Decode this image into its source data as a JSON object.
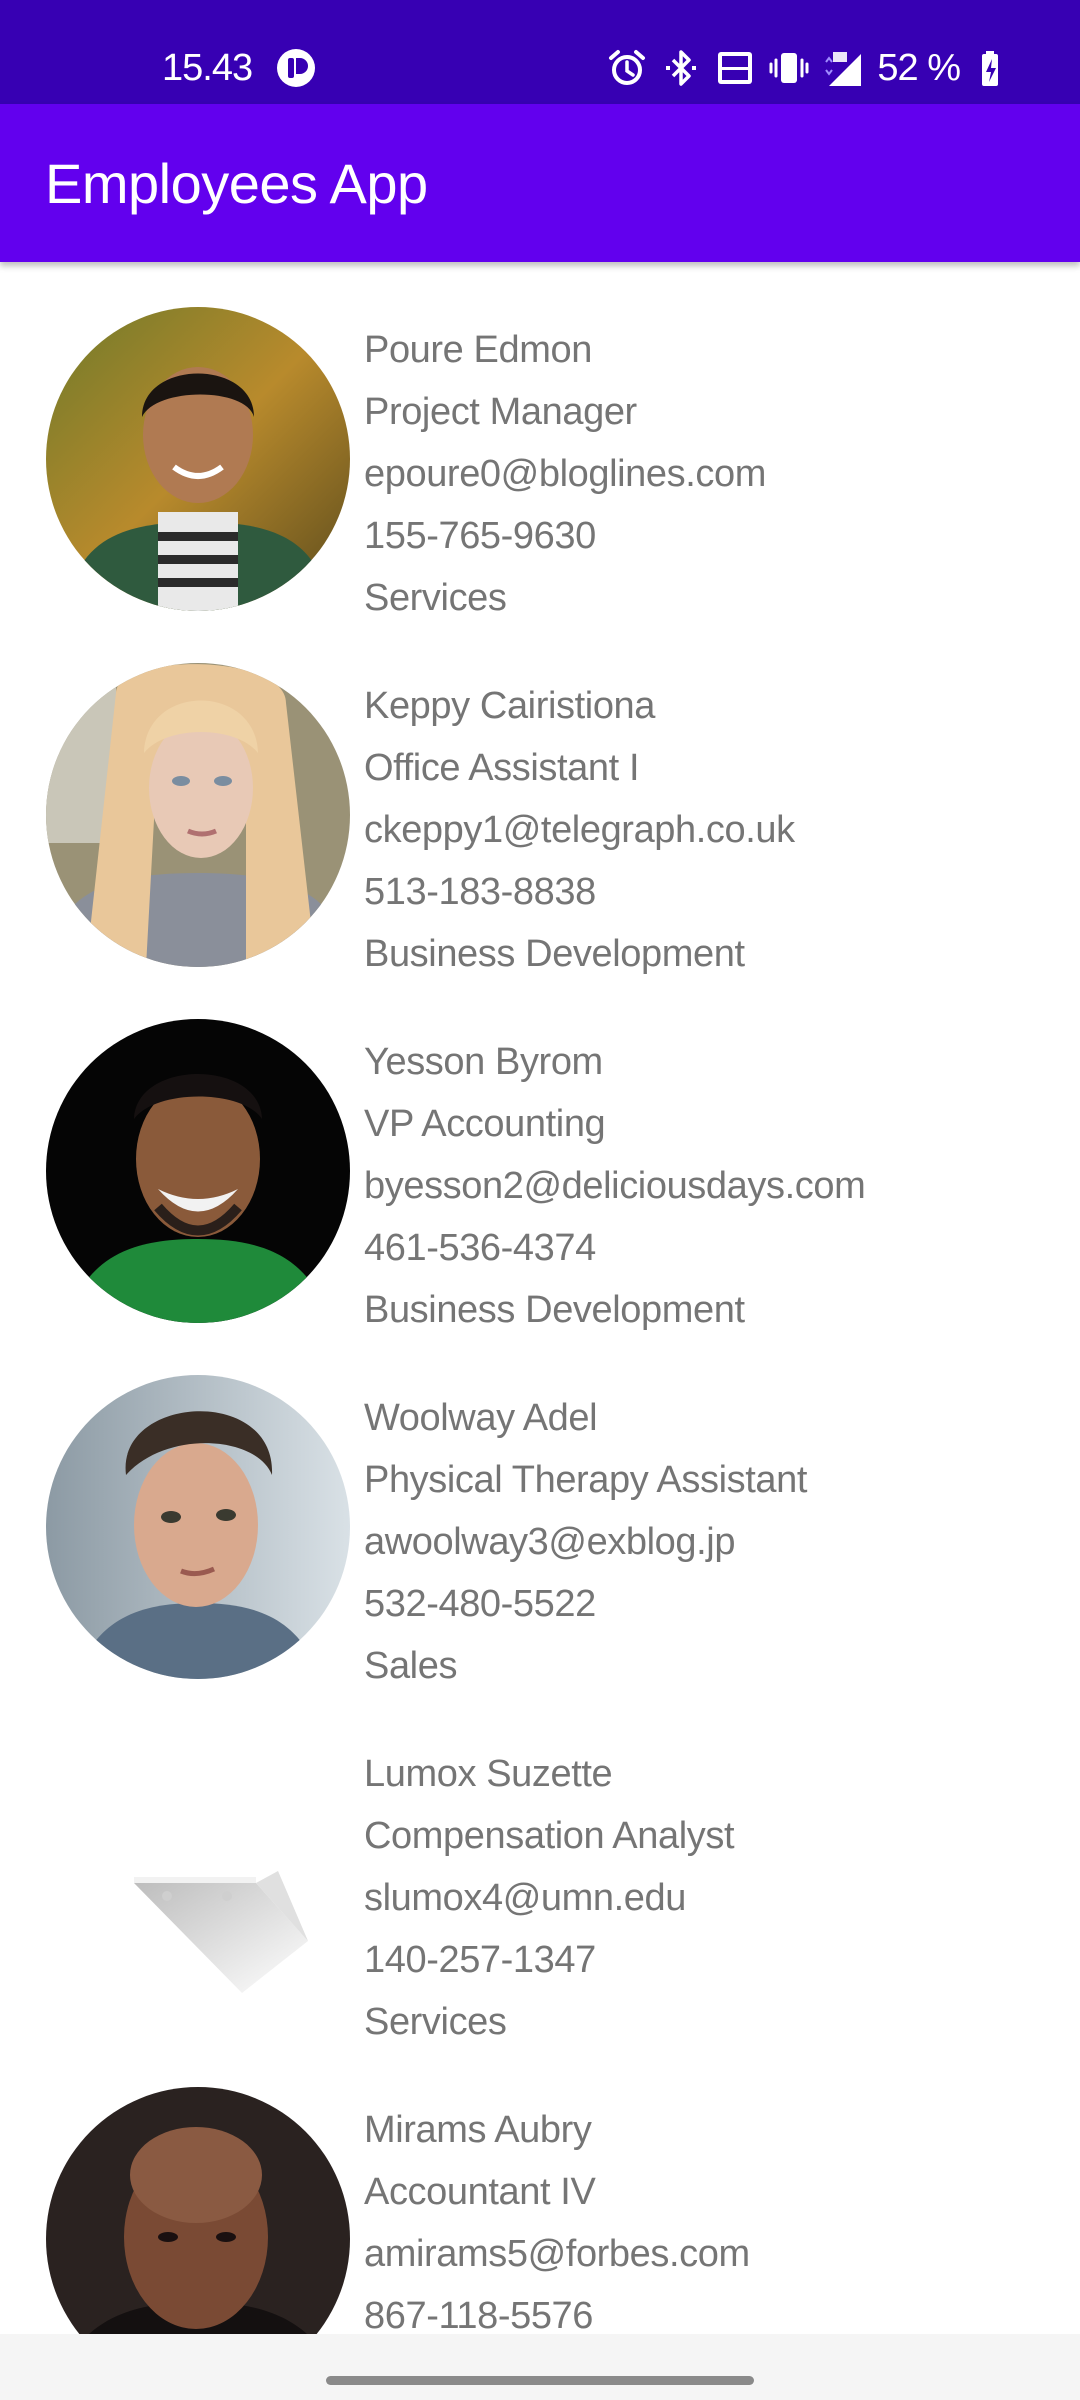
{
  "status_bar": {
    "time": "15.43",
    "battery": "52 %",
    "icons": [
      "notification-icon",
      "alarm-icon",
      "bluetooth-icon",
      "volte-icon",
      "vibrate-icon",
      "signal-4g-icon",
      "battery-charging-icon"
    ]
  },
  "app_bar": {
    "title": "Employees App"
  },
  "colors": {
    "status_bar": "#3700b3",
    "app_bar": "#6200ee",
    "text": "#757575"
  },
  "employees": [
    {
      "name": "Poure Edmon",
      "title": "Project Manager",
      "email": "epoure0@bloglines.com",
      "phone": "155-765-9630",
      "department": "Services"
    },
    {
      "name": "Keppy Cairistiona",
      "title": "Office Assistant I",
      "email": "ckeppy1@telegraph.co.uk",
      "phone": "513-183-8838",
      "department": "Business Development"
    },
    {
      "name": "Yesson Byrom",
      "title": "VP Accounting",
      "email": "byesson2@deliciousdays.com",
      "phone": "461-536-4374",
      "department": "Business Development"
    },
    {
      "name": "Woolway Adel",
      "title": "Physical Therapy Assistant",
      "email": "awoolway3@exblog.jp",
      "phone": "532-480-5522",
      "department": "Sales"
    },
    {
      "name": "Lumox Suzette",
      "title": "Compensation Analyst",
      "email": "slumox4@umn.edu",
      "phone": "140-257-1347",
      "department": "Services"
    },
    {
      "name": "Mirams Aubry",
      "title": "Accountant IV",
      "email": "amirams5@forbes.com",
      "phone": "867-118-5576",
      "department": ""
    }
  ]
}
